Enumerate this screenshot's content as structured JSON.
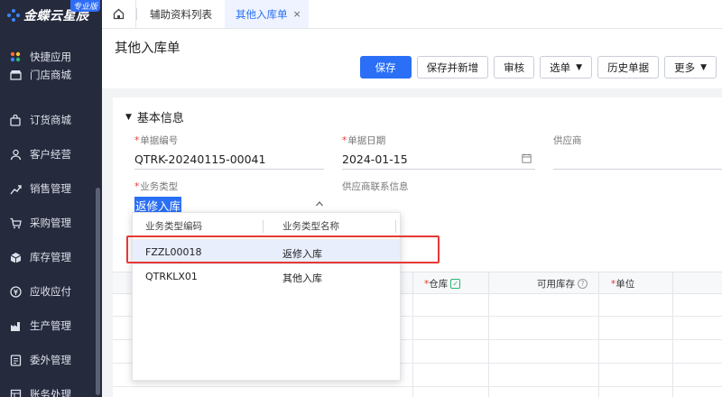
{
  "brand": {
    "name": "金蝶云星辰",
    "badge": "专业版"
  },
  "sidebar": {
    "items": [
      {
        "label": "快捷应用",
        "icon": "apps-icon"
      },
      {
        "label": "门店商城",
        "icon": "store-icon"
      },
      {
        "label": "订货商城",
        "icon": "bag-icon"
      },
      {
        "label": "客户经营",
        "icon": "customer-icon"
      },
      {
        "label": "销售管理",
        "icon": "sales-icon"
      },
      {
        "label": "采购管理",
        "icon": "cart-icon"
      },
      {
        "label": "库存管理",
        "icon": "box-icon"
      },
      {
        "label": "应收应付",
        "icon": "money-icon"
      },
      {
        "label": "生产管理",
        "icon": "factory-icon"
      },
      {
        "label": "委外管理",
        "icon": "outsource-icon"
      },
      {
        "label": "账务处理",
        "icon": "ledger-icon"
      }
    ]
  },
  "tabs": [
    {
      "label": "辅助资料列表"
    },
    {
      "label": "其他入库单",
      "close": "×"
    }
  ],
  "header": {
    "title": "其他入库单",
    "buttons": {
      "save": "保存",
      "save_new": "保存并新增",
      "audit": "审核",
      "select": "选单",
      "history": "历史单据",
      "more": "更多"
    }
  },
  "form": {
    "section_title": "基本信息",
    "bill_no": {
      "label": "单据编号",
      "value": "QTRK-20240115-00041"
    },
    "bill_date": {
      "label": "单据日期",
      "value": "2024-01-15"
    },
    "supplier": {
      "label": "供应商"
    },
    "biz_type": {
      "label": "业务类型",
      "value": "返修入库"
    },
    "supplier_contact": {
      "label": "供应商联系信息"
    }
  },
  "grid": {
    "warehouse": "仓库",
    "available_stock": "可用库存",
    "unit": "单位",
    "required_mark": "*"
  },
  "dropdown": {
    "col_code": "业务类型编码",
    "col_name": "业务类型名称",
    "rows": [
      {
        "code": "FZZL00018",
        "name": "返修入库"
      },
      {
        "code": "QTRKLX01",
        "name": "其他入库"
      }
    ]
  }
}
